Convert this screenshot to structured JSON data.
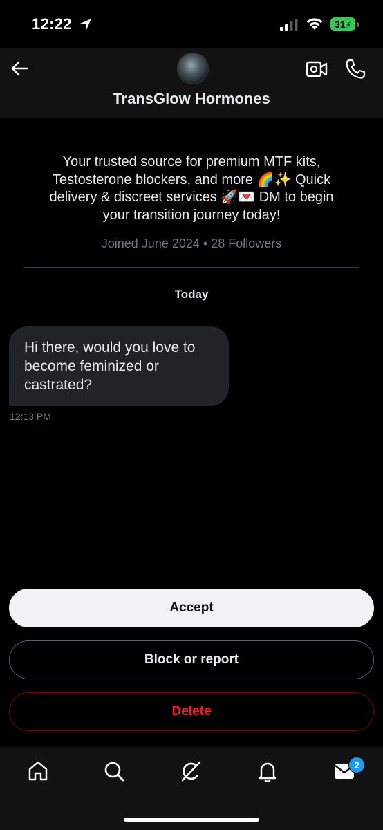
{
  "status_bar": {
    "time": "12:22",
    "battery": "31"
  },
  "header": {
    "name": "TransGlow Hormones"
  },
  "profile": {
    "bio_line1": "Your trusted source for premium MTF kits,",
    "bio_line2": "Testosterone blockers, and more 🌈✨ Quick",
    "bio_line3": "delivery & discreet services 🚀💌 DM to begin",
    "bio_line4": "your transition journey today!",
    "joined": "Joined June 2024 • 28 Followers"
  },
  "conversation": {
    "date_separator": "Today",
    "messages": [
      {
        "line1": "Hi there, would you love to",
        "line2": "become feminized or",
        "line3": "castrated?",
        "time": "12:13 PM"
      }
    ]
  },
  "actions": {
    "accept": "Accept",
    "block": "Block or report",
    "delete": "Delete"
  },
  "bottom_nav": {
    "items": [
      "home-icon",
      "search-icon",
      "grok-icon",
      "notifications-icon",
      "messages-icon"
    ],
    "messages_badge": "2"
  },
  "colors": {
    "accent": "#1d9bf0",
    "danger": "#f4212e",
    "bubble": "#202327",
    "background": "#000000"
  }
}
